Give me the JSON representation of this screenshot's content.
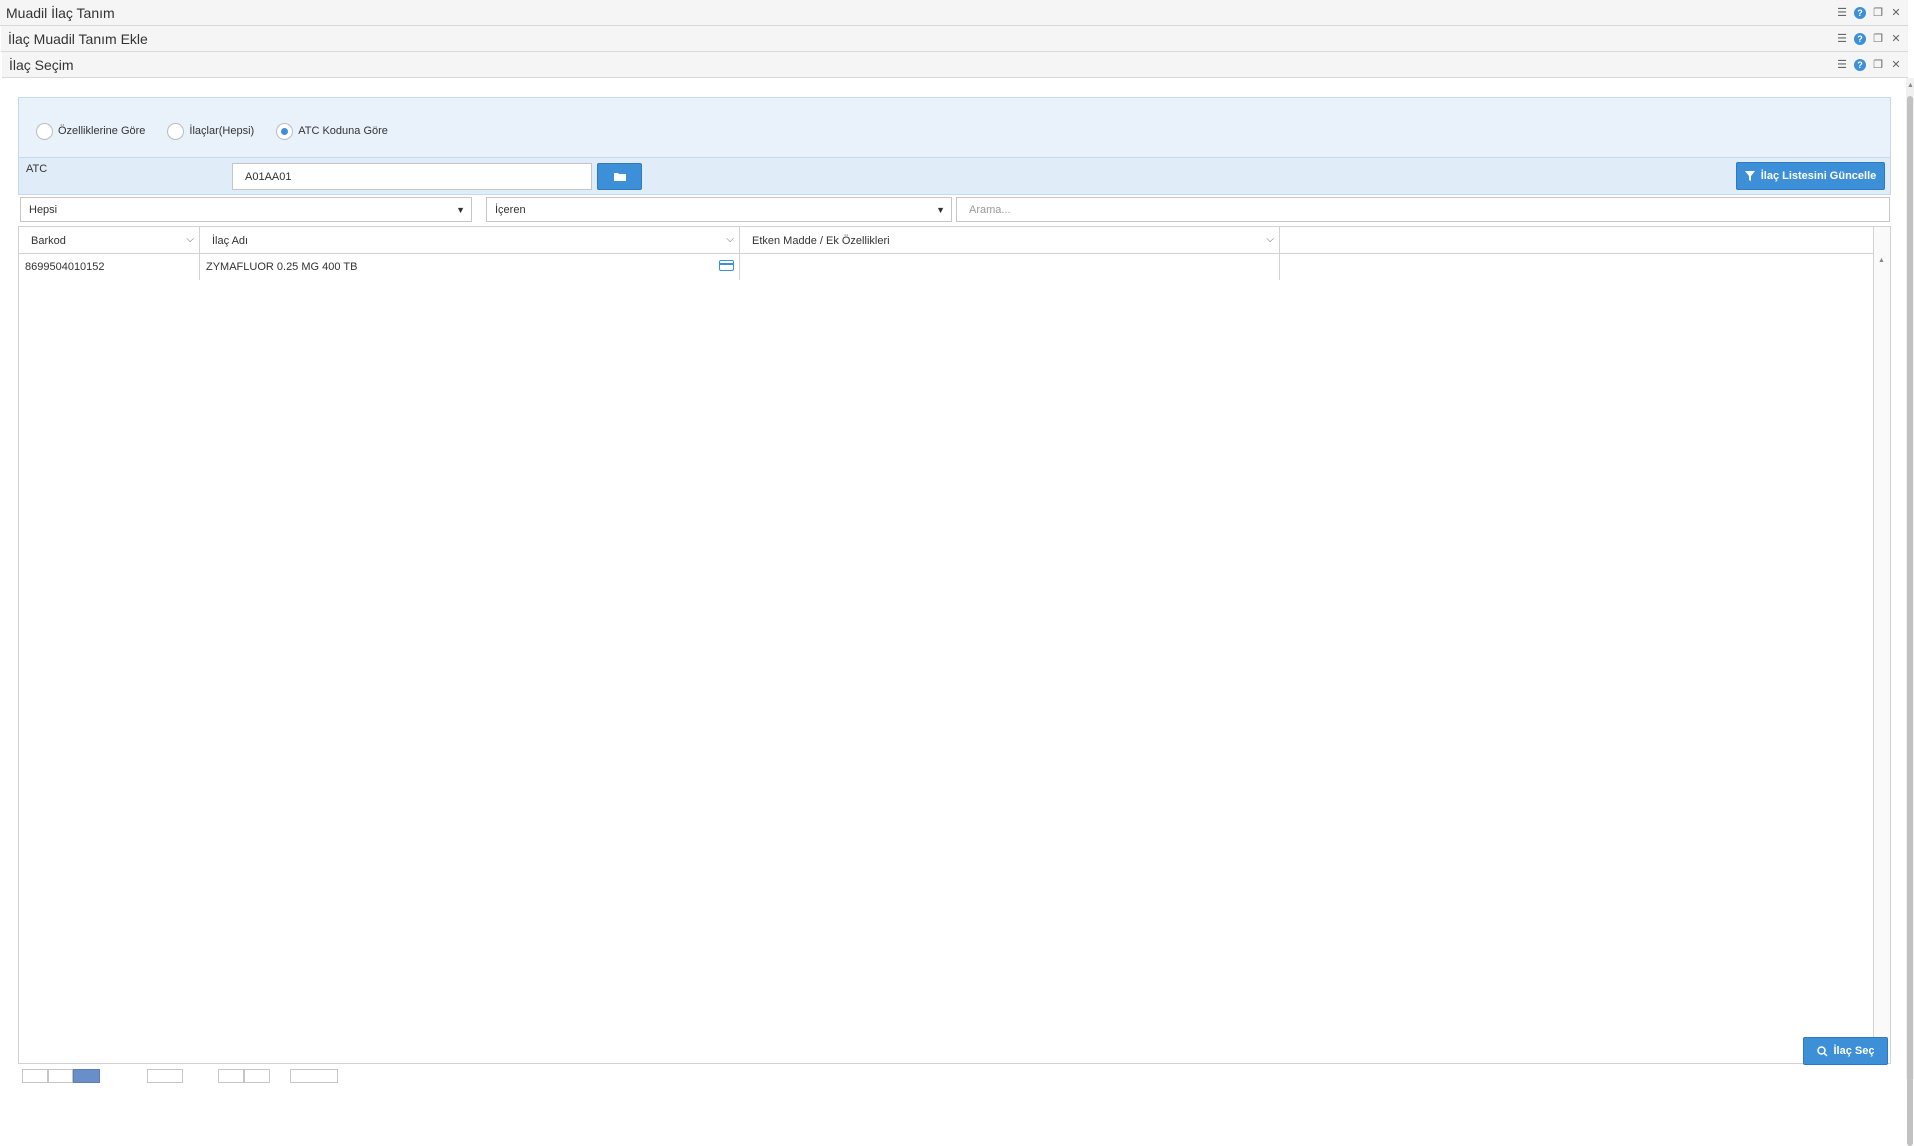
{
  "windows": [
    {
      "title": "Muadil İlaç Tanım"
    },
    {
      "title": "İlaç Muadil Tanım Ekle"
    },
    {
      "title": "İlaç Seçim"
    }
  ],
  "radio_options": [
    {
      "label": "Özelliklerine Göre",
      "checked": false
    },
    {
      "label": "İlaçlar(Hepsi)",
      "checked": false
    },
    {
      "label": "ATC Koduna Göre",
      "checked": true
    }
  ],
  "atc": {
    "label": "ATC",
    "value": "A01AA01",
    "update_button": "İlaç Listesini Güncelle"
  },
  "filters": {
    "scope_select": "Hepsi",
    "match_select": "İçeren",
    "search_placeholder": "Arama..."
  },
  "grid": {
    "columns": [
      "Barkod",
      "İlaç Adı",
      "Etken Madde / Ek Özellikleri"
    ],
    "rows": [
      {
        "barkod": "8699504010152",
        "ilac_adi": "ZYMAFLUOR 0.25 MG 400 TB",
        "etken": ""
      }
    ]
  },
  "select_button": "İlaç Seç",
  "colors": {
    "accent": "#3d8fd8"
  }
}
